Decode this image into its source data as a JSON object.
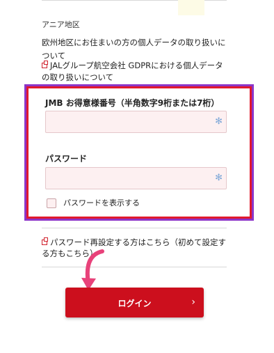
{
  "header": {
    "region_text": "アニア地区"
  },
  "notices": {
    "europe_text": "欧州地区にお住まいの方の個人データの取り扱いについて",
    "gdpr_link": "JALグループ航空会社 GDPRにおける個人データの取り扱いについて"
  },
  "login_form": {
    "member_number_label": "JMB お得意様番号（半角数字9桁または7桁）",
    "member_number_value": "",
    "password_label": "パスワード",
    "password_value": "",
    "show_password_label": "パスワードを表示する",
    "show_password_checked": false,
    "field_icon": "asterisk-icon"
  },
  "links": {
    "password_reset": "パスワード再設定する方はこちら（初めて設定する方もこちら）"
  },
  "login_button": {
    "label": "ログイン",
    "chevron": "›"
  },
  "colors": {
    "brand_red": "#cc0f1d",
    "highlight_border": "#e0192d",
    "annotation_purple": "#8c35c8",
    "annotation_arrow": "#e8427a",
    "input_background": "#fdf0f1"
  },
  "annotations": {
    "arrow_icon": "curved-arrow-icon"
  }
}
